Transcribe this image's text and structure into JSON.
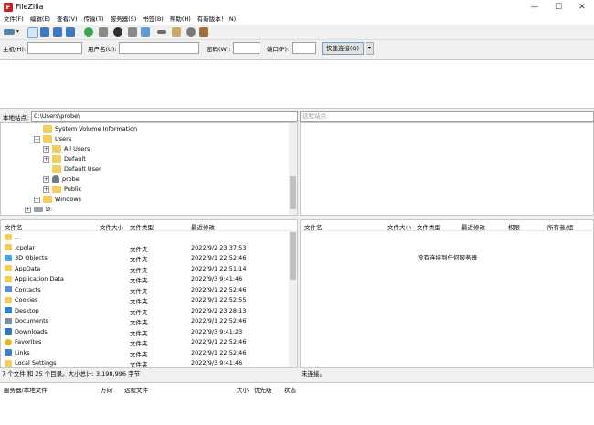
{
  "window": {
    "title": "FileZilla",
    "app_icon_glyph": "F",
    "controls": {
      "minimize": "—",
      "maximize": "☐",
      "close": "✕"
    }
  },
  "menu": [
    "文件(F)",
    "编辑(E)",
    "查看(V)",
    "传输(T)",
    "服务器(S)",
    "书签(B)",
    "帮助(H)",
    "有新版本！(N)"
  ],
  "toolbar": {
    "icons": [
      "site-manager-icon",
      "dropdown-icon",
      "toggle-log-icon",
      "toggle-local-tree-icon",
      "toggle-remote-tree-icon",
      "toggle-queue-icon",
      "refresh-icon",
      "process-queue-icon",
      "cancel-icon",
      "disconnect-icon",
      "reconnect-icon",
      "filter-icon",
      "compare-icon",
      "sync-browse-icon",
      "search-icon"
    ]
  },
  "quickconnect": {
    "host_label": "主机(H):",
    "user_label": "用户名(U):",
    "password_label": "密码(W):",
    "port_label": "端口(P):",
    "host_value": "",
    "user_value": "",
    "password_value": "",
    "port_value": "",
    "connect_button": "快速连接(Q)",
    "dropdown_glyph": "▾"
  },
  "local_site": {
    "label": "本地站点:",
    "path": "C:\\Users\\probe\\",
    "tree": [
      {
        "label": "System Volume Information",
        "type": "folder",
        "expander": ""
      },
      {
        "label": "Users",
        "type": "folder",
        "expander": "−"
      },
      {
        "label": "All Users",
        "type": "folder",
        "expander": "+"
      },
      {
        "label": "Default",
        "type": "folder",
        "expander": "+"
      },
      {
        "label": "Default User",
        "type": "folder",
        "expander": ""
      },
      {
        "label": "probe",
        "type": "user",
        "expander": "+"
      },
      {
        "label": "Public",
        "type": "folder",
        "expander": "+"
      },
      {
        "label": "Windows",
        "type": "folder",
        "expander": "+"
      },
      {
        "label": "D:",
        "type": "drive",
        "expander": "+"
      }
    ]
  },
  "remote_site": {
    "label": "远程站点:",
    "path": "",
    "empty_message": "没有连接到任何服务器"
  },
  "local_files": {
    "columns": [
      "文件名",
      "文件大小",
      "文件类型",
      "最近修改"
    ],
    "rows": [
      {
        "name": "..",
        "size": "",
        "type": "",
        "modified": "",
        "icon": "folder-icon",
        "color": "#f5cd5b"
      },
      {
        "name": ".cpolar",
        "size": "",
        "type": "文件夹",
        "modified": "2022/9/2 23:37:53",
        "icon": "folder-icon",
        "color": "#f5cd5b"
      },
      {
        "name": "3D Objects",
        "size": "",
        "type": "文件夹",
        "modified": "2022/9/1 22:52:46",
        "icon": "3d-objects-icon",
        "color": "#4aa3e0"
      },
      {
        "name": "AppData",
        "size": "",
        "type": "文件夹",
        "modified": "2022/9/1 22:51:14",
        "icon": "folder-icon",
        "color": "#f5cd5b"
      },
      {
        "name": "Application Data",
        "size": "",
        "type": "文件夹",
        "modified": "2022/9/3 9:41:46",
        "icon": "folder-icon",
        "color": "#f5cd5b"
      },
      {
        "name": "Contacts",
        "size": "",
        "type": "文件夹",
        "modified": "2022/9/1 22:52:46",
        "icon": "contacts-icon",
        "color": "#5a8fd0"
      },
      {
        "name": "Cookies",
        "size": "",
        "type": "文件夹",
        "modified": "2022/9/1 22:52:55",
        "icon": "folder-icon",
        "color": "#f5cd5b"
      },
      {
        "name": "Desktop",
        "size": "",
        "type": "文件夹",
        "modified": "2022/9/2 23:28:13",
        "icon": "desktop-icon",
        "color": "#2e7fd6"
      },
      {
        "name": "Documents",
        "size": "",
        "type": "文件夹",
        "modified": "2022/9/1 22:52:46",
        "icon": "documents-icon",
        "color": "#7a8ea8"
      },
      {
        "name": "Downloads",
        "size": "",
        "type": "文件夹",
        "modified": "2022/9/3 9:41:23",
        "icon": "downloads-icon",
        "color": "#2a77c9"
      },
      {
        "name": "Favorites",
        "size": "",
        "type": "文件夹",
        "modified": "2022/9/1 22:52:46",
        "icon": "favorites-icon",
        "color": "#e8b923"
      },
      {
        "name": "Links",
        "size": "",
        "type": "文件夹",
        "modified": "2022/9/1 22:52:46",
        "icon": "links-icon",
        "color": "#3b82c4"
      },
      {
        "name": "Local Settings",
        "size": "",
        "type": "文件夹",
        "modified": "2022/9/3 9:41:46",
        "icon": "folder-icon",
        "color": "#f5cd5b"
      }
    ],
    "status": "7 个文件 和 25 个目录。大小总计: 3,198,996 字节"
  },
  "remote_files": {
    "columns": [
      "文件名",
      "文件大小",
      "文件类型",
      "最近修改",
      "权限",
      "所有者/组"
    ],
    "empty_message": "没有连接到任何服务器",
    "status": "未连接。"
  },
  "queue": {
    "columns": [
      "服务器/本地文件",
      "方向",
      "远程文件",
      "大小",
      "优先级",
      "状态"
    ]
  }
}
